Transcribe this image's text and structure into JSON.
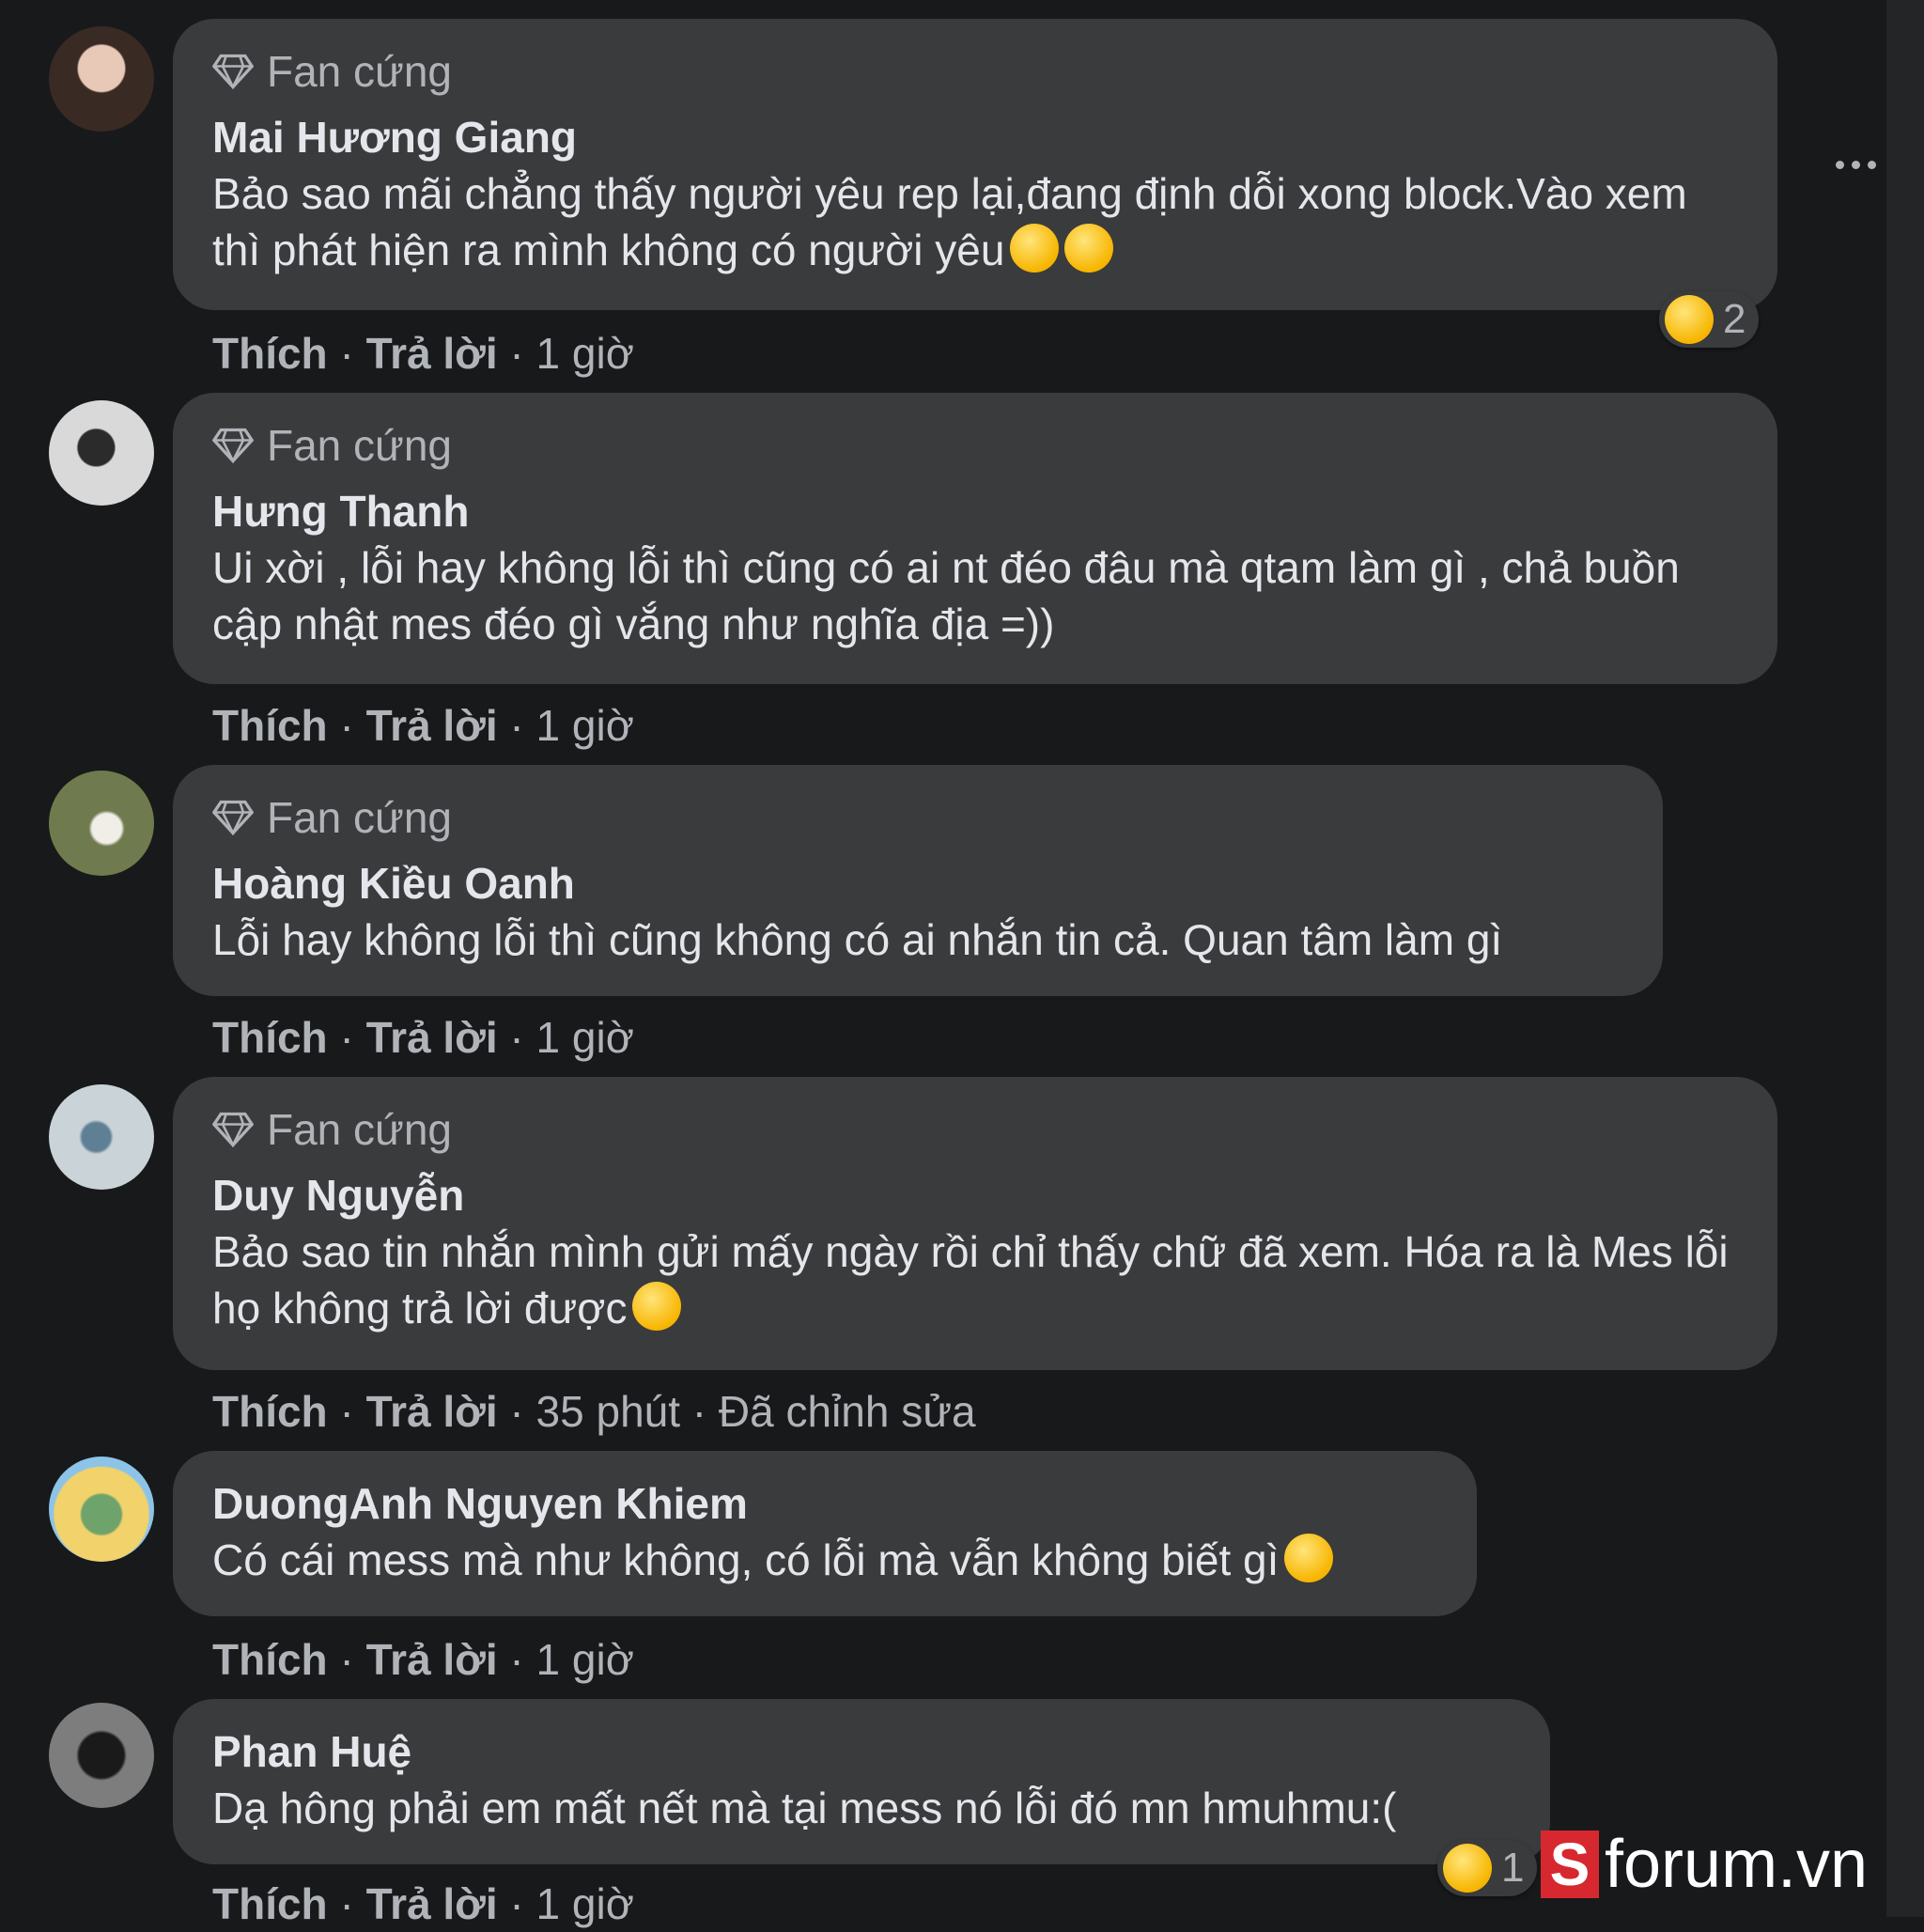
{
  "badge_label": "Fan cứng",
  "action_like": "Thích",
  "action_reply": "Trả lời",
  "separator": " · ",
  "comments": [
    {
      "author": "Mai Hương Giang",
      "text": "Bảo sao mãi chẳng thấy người yêu rep lại,đang định dỗi xong block.Vào xem thì phát hiện ra mình không có người yêu",
      "time": "1 giờ",
      "reaction_count": "2"
    },
    {
      "author": "Hưng Thanh",
      "text": "Ui xời , lỗi hay không lỗi thì cũng có ai nt đéo đâu mà qtam làm gì , chả buồn cập nhật mes đéo gì vắng như nghĩa địa =))",
      "time": "1 giờ"
    },
    {
      "author": "Hoàng Kiều Oanh",
      "text": "Lỗi hay không lỗi thì cũng không có ai nhắn tin cả. Quan tâm làm gì",
      "time": "1 giờ"
    },
    {
      "author": "Duy Nguyễn",
      "text": "Bảo sao tin nhắn mình gửi mấy ngày rồi chỉ thấy chữ đã xem. Hóa ra là Mes lỗi họ không trả lời được",
      "time": "35 phút",
      "edited": "Đã chỉnh sửa"
    },
    {
      "author": "DuongAnh Nguyen Khiem",
      "text": "Có cái mess mà như không, có lỗi mà vẫn không biết gì",
      "time": "1 giờ"
    },
    {
      "author": "Phan Huệ",
      "text": "Dạ hông phải em mất nết mà tại mess nó lỗi đó mn hmuhmu:(",
      "time": "1 giờ",
      "reaction_count": "1"
    }
  ],
  "watermark": {
    "letter": "S",
    "word": "forum.vn"
  },
  "colors": {
    "background": "#18191a",
    "bubble": "#3a3b3c",
    "text": "#e4e6eb",
    "secondary": "#b0b3b8",
    "brand_red": "#d7282f"
  },
  "icons": [
    "diamond-icon",
    "more-options-icon",
    "laughing-emoji-icon",
    "grinning-emoji-icon",
    "smile-emoji-icon",
    "relieved-emoji-icon"
  ]
}
